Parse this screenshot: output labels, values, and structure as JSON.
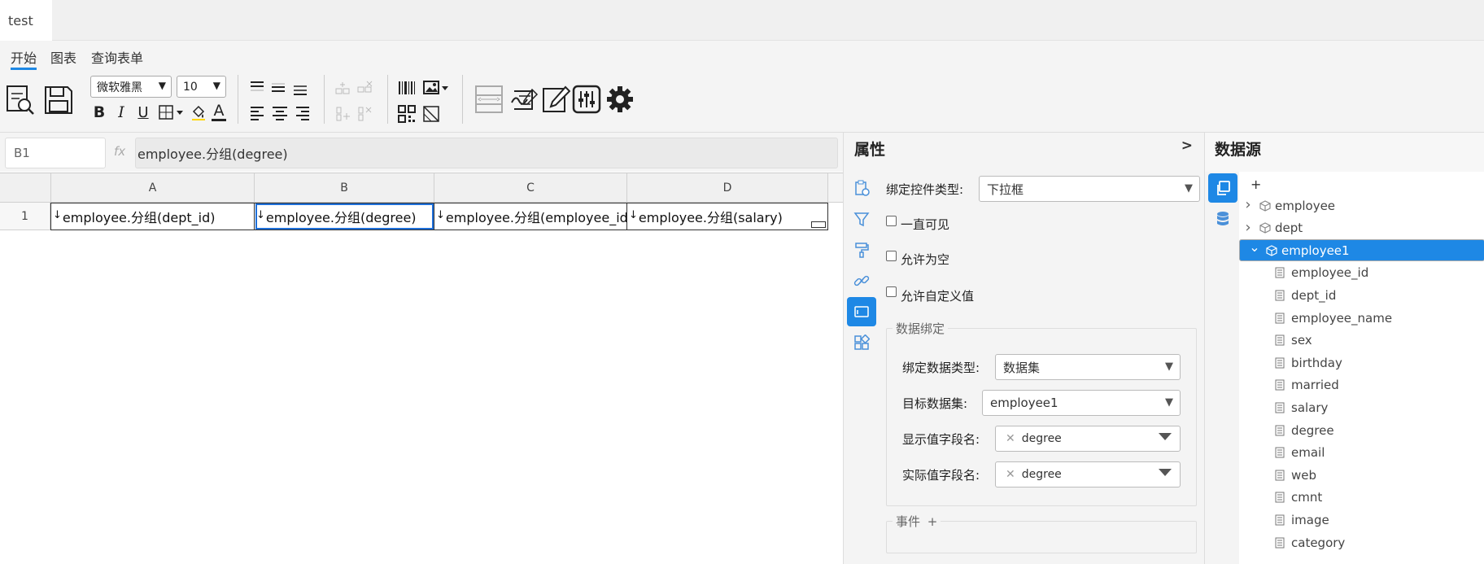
{
  "file_tab": {
    "label": "test"
  },
  "ribbon": {
    "tabs": [
      {
        "label": "开始",
        "active": true
      },
      {
        "label": "图表"
      },
      {
        "label": "查询表单"
      }
    ],
    "font_family": "微软雅黑",
    "font_size": "10",
    "bold_label": "B",
    "italic_label": "I",
    "underline_label": "U",
    "font_color_label": "A"
  },
  "formula_bar": {
    "cell_ref": "B1",
    "fx_label": "fx",
    "formula": "employee.分组(degree)"
  },
  "grid": {
    "columns": [
      "A",
      "B",
      "C",
      "D"
    ],
    "rows": [
      {
        "number": "1",
        "cells": [
          "employee.分组(dept_id)",
          "employee.分组(degree)",
          "employee.分组(employee_id)",
          "employee.分组(salary)"
        ]
      }
    ],
    "selected": "B1"
  },
  "properties": {
    "title": "属性",
    "collapse_label": ">",
    "control_type_label": "绑定控件类型:",
    "control_type_value": "下拉框",
    "always_visible_label": "一直可见",
    "allow_empty_label": "允许为空",
    "allow_custom_label": "允许自定义值",
    "binding_legend": "数据绑定",
    "binding_type_label": "绑定数据类型:",
    "binding_type_value": "数据集",
    "target_dataset_label": "目标数据集:",
    "target_dataset_value": "employee1",
    "display_field_label": "显示值字段名:",
    "display_field_value": "degree",
    "actual_field_label": "实际值字段名:",
    "actual_field_value": "degree",
    "events_legend": "事件",
    "events_add": "+"
  },
  "datasource": {
    "title": "数据源",
    "add_label": "+",
    "datasets": [
      {
        "name": "employee",
        "expanded": false
      },
      {
        "name": "dept",
        "expanded": false
      },
      {
        "name": "employee1",
        "expanded": true,
        "selected": true
      }
    ],
    "fields": [
      "employee_id",
      "dept_id",
      "employee_name",
      "sex",
      "birthday",
      "married",
      "salary",
      "degree",
      "email",
      "web",
      "cmnt",
      "image",
      "category"
    ]
  },
  "colors": {
    "accent": "#1e88e5",
    "icon_blue": "#4a90d9"
  }
}
